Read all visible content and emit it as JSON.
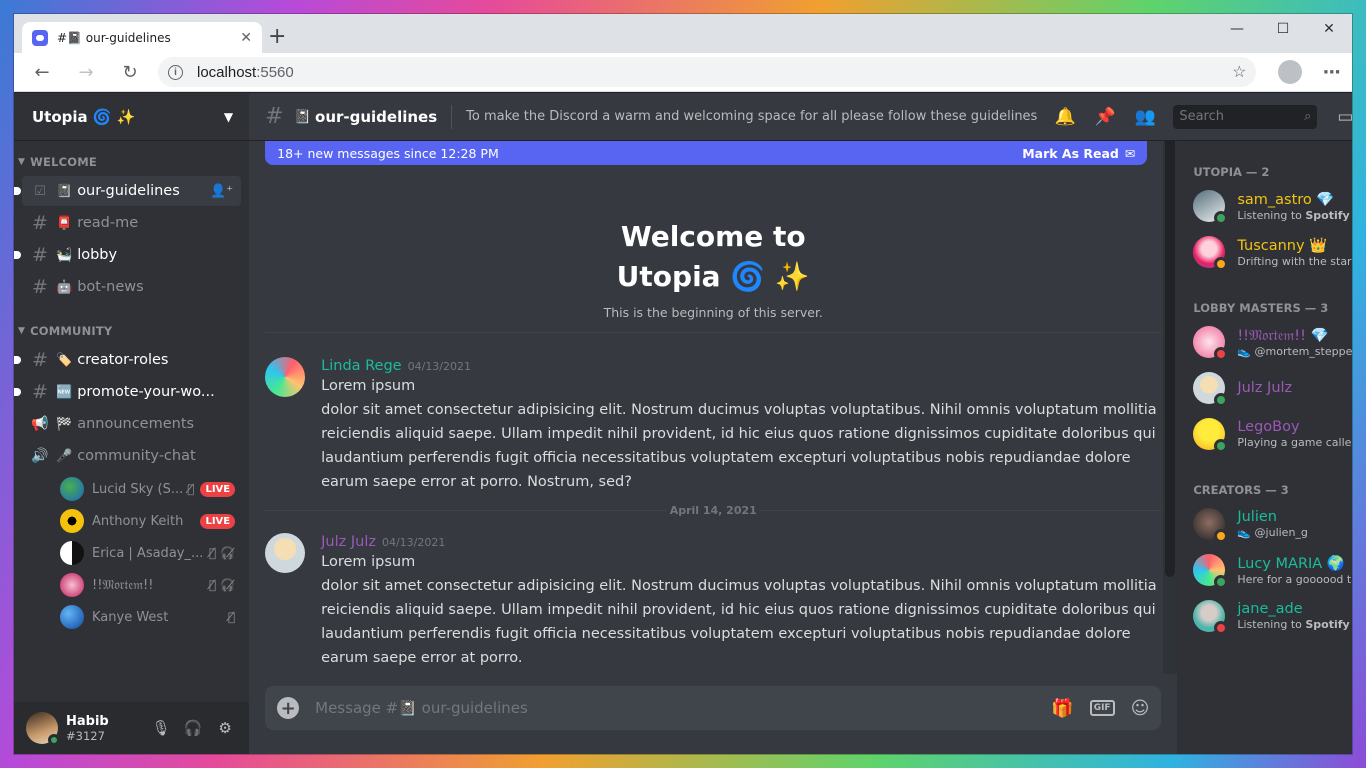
{
  "browser": {
    "tab_title": "#📓 our-guidelines",
    "url_host": "localhost",
    "url_port": ":5560"
  },
  "server": {
    "name": "Utopia 🌀 ✨"
  },
  "categories": {
    "welcome": "WELCOME",
    "community": "COMMUNITY"
  },
  "channels_welcome": [
    {
      "emoji": "📓",
      "name": "our-guidelines"
    },
    {
      "emoji": "📮",
      "name": "read-me"
    },
    {
      "emoji": "🛀",
      "name": "lobby"
    },
    {
      "emoji": "🤖",
      "name": "bot-news"
    }
  ],
  "channels_community": [
    {
      "emoji": "🏷️",
      "name": "creator-roles"
    },
    {
      "emoji": "🆕",
      "name": "promote-your-wo..."
    },
    {
      "emoji": "🏁",
      "name": "announcements"
    },
    {
      "emoji": "🎤",
      "name": "community-chat"
    }
  ],
  "voice_users": [
    {
      "name": "Lucid Sky (S...",
      "live": "LIVE"
    },
    {
      "name": "Anthony Keith",
      "live": "LIVE"
    },
    {
      "name": "Erica | Asaday_..."
    },
    {
      "name": "!!𝔐𝔬𝔯𝔱𝔢𝔪!!"
    },
    {
      "name": "Kanye West"
    }
  ],
  "user": {
    "name": "Habib",
    "tag": "#3127"
  },
  "header": {
    "channel_name": "our-guidelines",
    "channel_emoji": "📓",
    "topic": "To make the Discord a warm and welcoming space for all please follow these guidelines",
    "search_placeholder": "Search"
  },
  "newbar": {
    "text": "18+ new messages since 12:28 PM",
    "action": "Mark As Read"
  },
  "welcome": {
    "line1": "Welcome to",
    "line2": "Utopia 🌀 ✨",
    "sub": "This is the beginning of this server."
  },
  "messages": [
    {
      "author": "Linda Rege",
      "author_color": "#1abc9c",
      "date": "04/13/2021",
      "line1": "Lorem ipsum",
      "line2": "dolor sit amet consectetur adipisicing elit. Nostrum ducimus voluptas voluptatibus. Nihil omnis voluptatum mollitia reiciendis aliquid saepe. Ullam impedit nihil provident, id hic eius quos ratione dignissimos cupiditate doloribus qui laudantium perferendis fugit officia necessitatibus voluptatem excepturi voluptatibus nobis repudiandae dolore earum saepe error at porro. Nostrum, sed?"
    },
    {
      "author": "Julz Julz",
      "author_color": "#9b59b6",
      "date": "04/13/2021",
      "line1": "Lorem ipsum",
      "line2": "dolor sit amet consectetur adipisicing elit. Nostrum ducimus voluptas voluptatibus. Nihil omnis voluptatum mollitia reiciendis aliquid saepe. Ullam impedit nihil provident, id hic eius quos ratione dignissimos cupiditate doloribus qui laudantium perferendis fugit officia necessitatibus voluptatem excepturi voluptatibus nobis repudiandae dolore earum saepe error at porro."
    }
  ],
  "date_separator": "April 14, 2021",
  "composer": {
    "placeholder": "Message #📓 our-guidelines",
    "gif": "GIF"
  },
  "members": {
    "group1": "UTOPIA — 2",
    "group2": "LOBBY MASTERS — 3",
    "group3": "CREATORS — 3",
    "list1": [
      {
        "name": "sam_astro 💎",
        "color": "#f1c40f",
        "act_pre": "Listening to ",
        "act_bold": "Spotify",
        "status": "#3ba55d"
      },
      {
        "name": "Tuscanny 👑",
        "color": "#f1c40f",
        "act_pre": "Drifting with the stars",
        "act_bold": "",
        "status": "#faa81a"
      }
    ],
    "list2": [
      {
        "name": "!!𝔐𝔬𝔯𝔱𝔢𝔪!! 💎",
        "color": "#9b59b6",
        "act_pre": "👟 @mortem_stepper",
        "act_bold": "",
        "status": "#ed4245"
      },
      {
        "name": "Julz Julz",
        "color": "#9b59b6",
        "act_pre": "",
        "act_bold": "",
        "status": "#3ba55d"
      },
      {
        "name": "LegoBoy",
        "color": "#9b59b6",
        "act_pre": "Playing a game called life",
        "act_bold": "",
        "status": "#3ba55d"
      }
    ],
    "list3": [
      {
        "name": "Julien",
        "color": "#1abc9c",
        "act_pre": "👟 @julien_g",
        "act_bold": "",
        "status": "#faa81a"
      },
      {
        "name": "Lucy MARIA 🌍",
        "color": "#1abc9c",
        "act_pre": "Here for a goooood time",
        "act_bold": "",
        "status": "#3ba55d"
      },
      {
        "name": "jane_ade",
        "color": "#1abc9c",
        "act_pre": "Listening to ",
        "act_bold": "Spotify",
        "status": "#ed4245"
      }
    ]
  },
  "colors": {
    "blurple": "#5865f2",
    "online": "#3ba55d",
    "idle": "#faa81a",
    "dnd": "#ed4245"
  }
}
